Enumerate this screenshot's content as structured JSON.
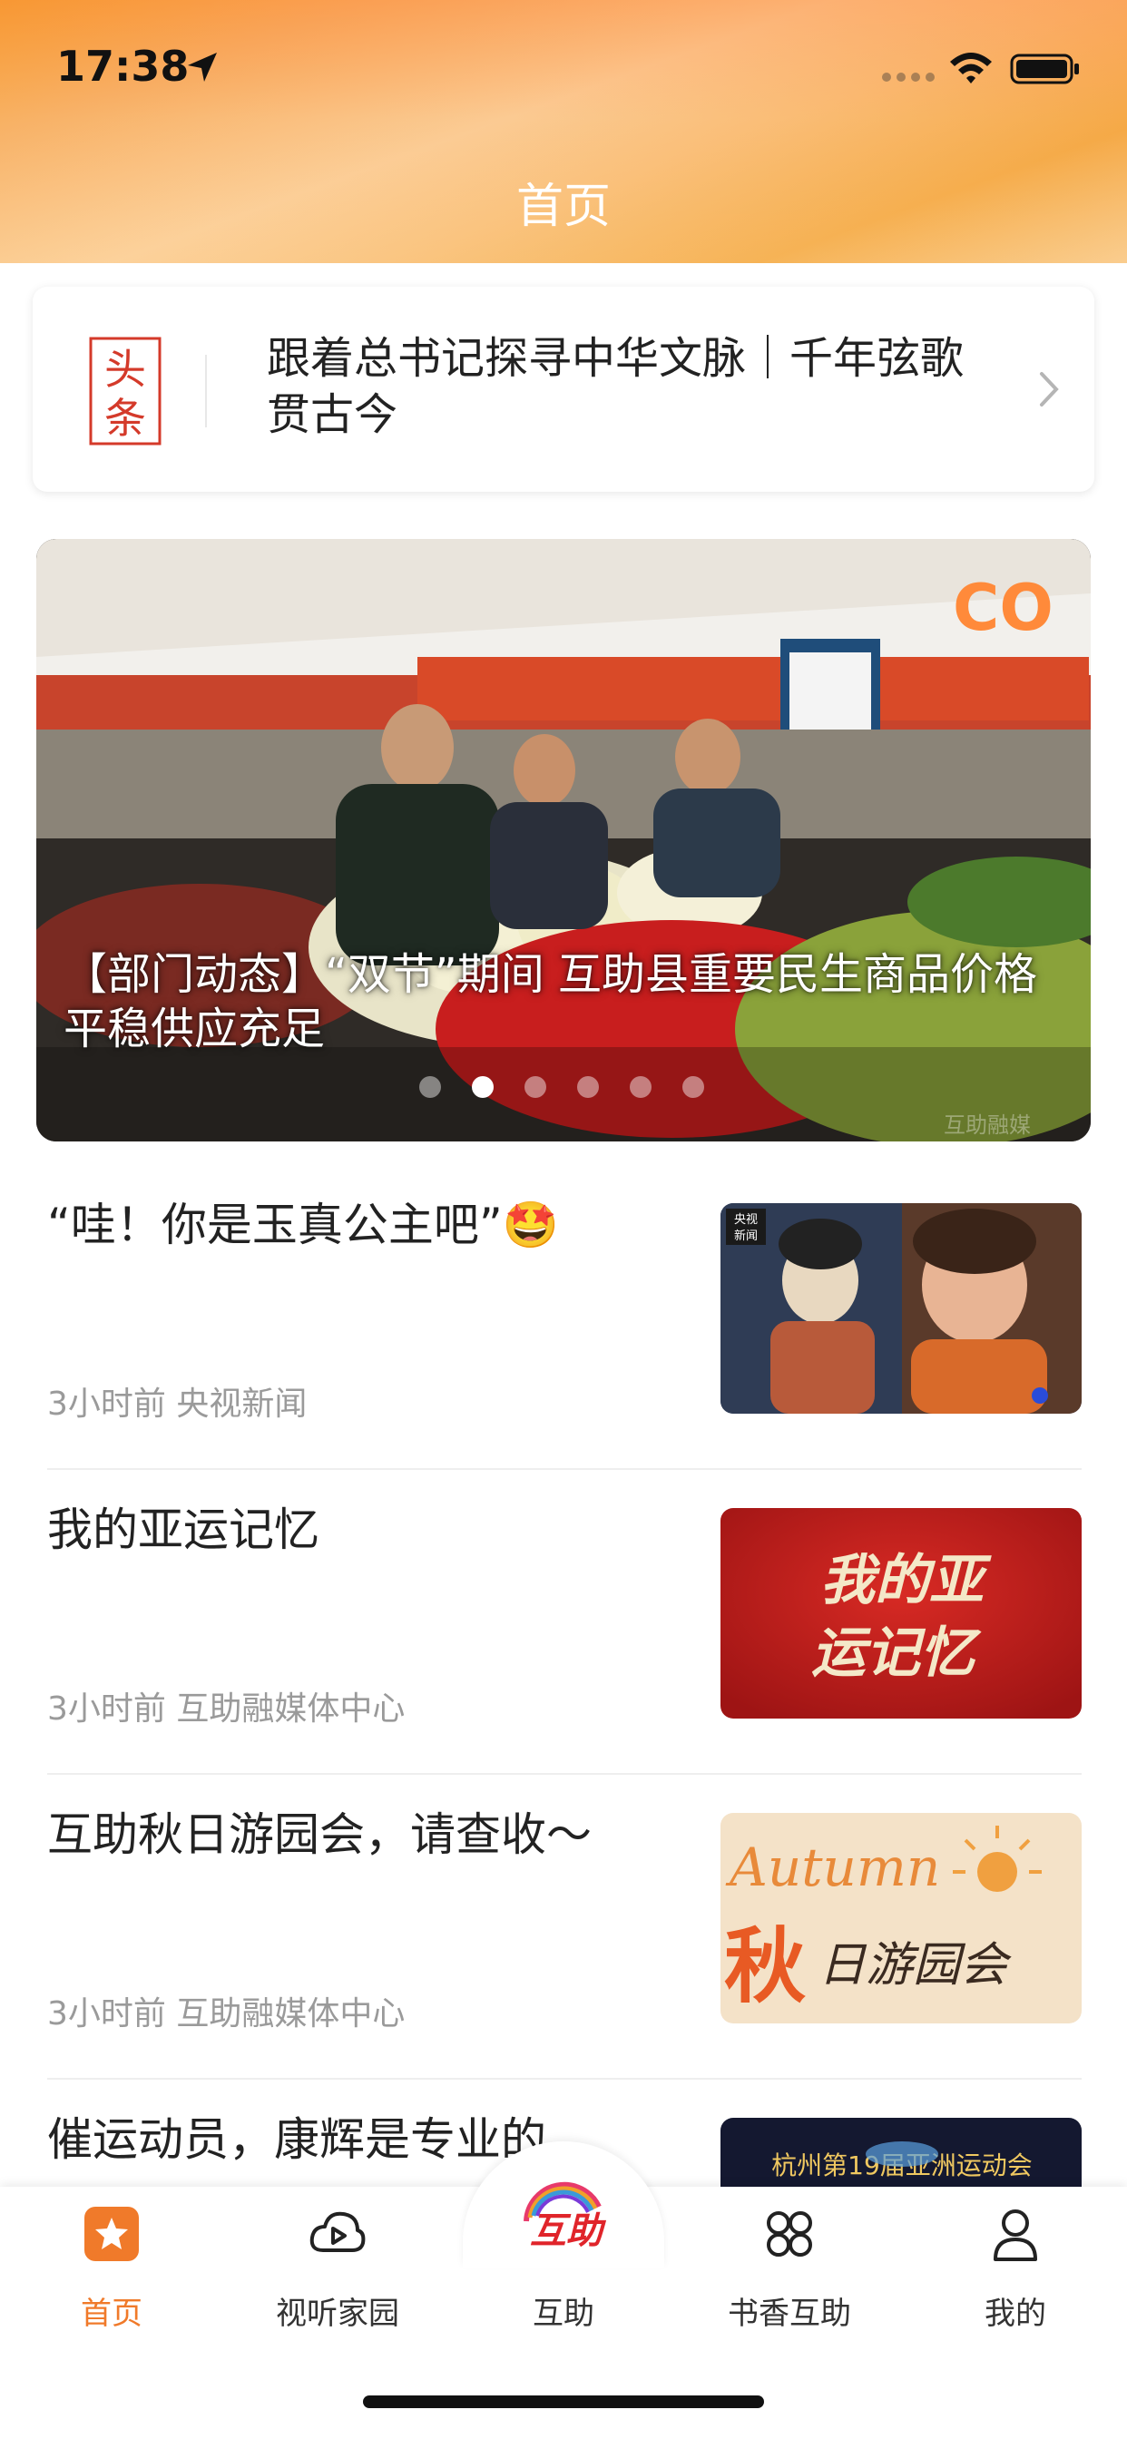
{
  "status_bar": {
    "time": "17:38"
  },
  "header": {
    "title": "首页"
  },
  "headline": {
    "logo_text": [
      "头",
      "条"
    ],
    "text": "跟着总书记探寻中华文脉｜千年弦歌贯古今"
  },
  "banner": {
    "caption": "【部门动态】“双节”期间 互助县重要民生商品价格平稳供应充足",
    "dot_count": 6,
    "active_index": 1,
    "watermark": "互助融媒"
  },
  "news": [
    {
      "title": "“哇！你是玉真公主吧”🤩",
      "meta": "3小时前 央视新闻",
      "thumb_badge": "央视\n新闻"
    },
    {
      "title": "我的亚运记忆",
      "meta": "3小时前 互助融媒体中心",
      "thumb_text": [
        "我的亚",
        "运记忆"
      ]
    },
    {
      "title": "互助秋日游园会，请查收～",
      "meta": "3小时前 互助融媒体中心",
      "thumb_text": [
        "Autumn",
        "秋",
        "日游园会"
      ]
    },
    {
      "title": "催运动员，康辉是专业的",
      "meta": "",
      "thumb_text": [
        "杭州第19届亚洲运动会"
      ]
    }
  ],
  "tabbar": {
    "tabs": [
      {
        "label": "首页",
        "icon": "star-icon",
        "active": true
      },
      {
        "label": "视听家园",
        "icon": "play-cloud-icon",
        "active": false
      },
      {
        "label": "互助",
        "icon": "huzhu-logo",
        "active": false
      },
      {
        "label": "书香互助",
        "icon": "grid-icon",
        "active": false
      },
      {
        "label": "我的",
        "icon": "user-icon",
        "active": false
      }
    ],
    "center_logo_text": "互助"
  },
  "colors": {
    "accent": "#f07a2a",
    "header_start": "#f5a93a",
    "header_end": "#f9c98a"
  }
}
